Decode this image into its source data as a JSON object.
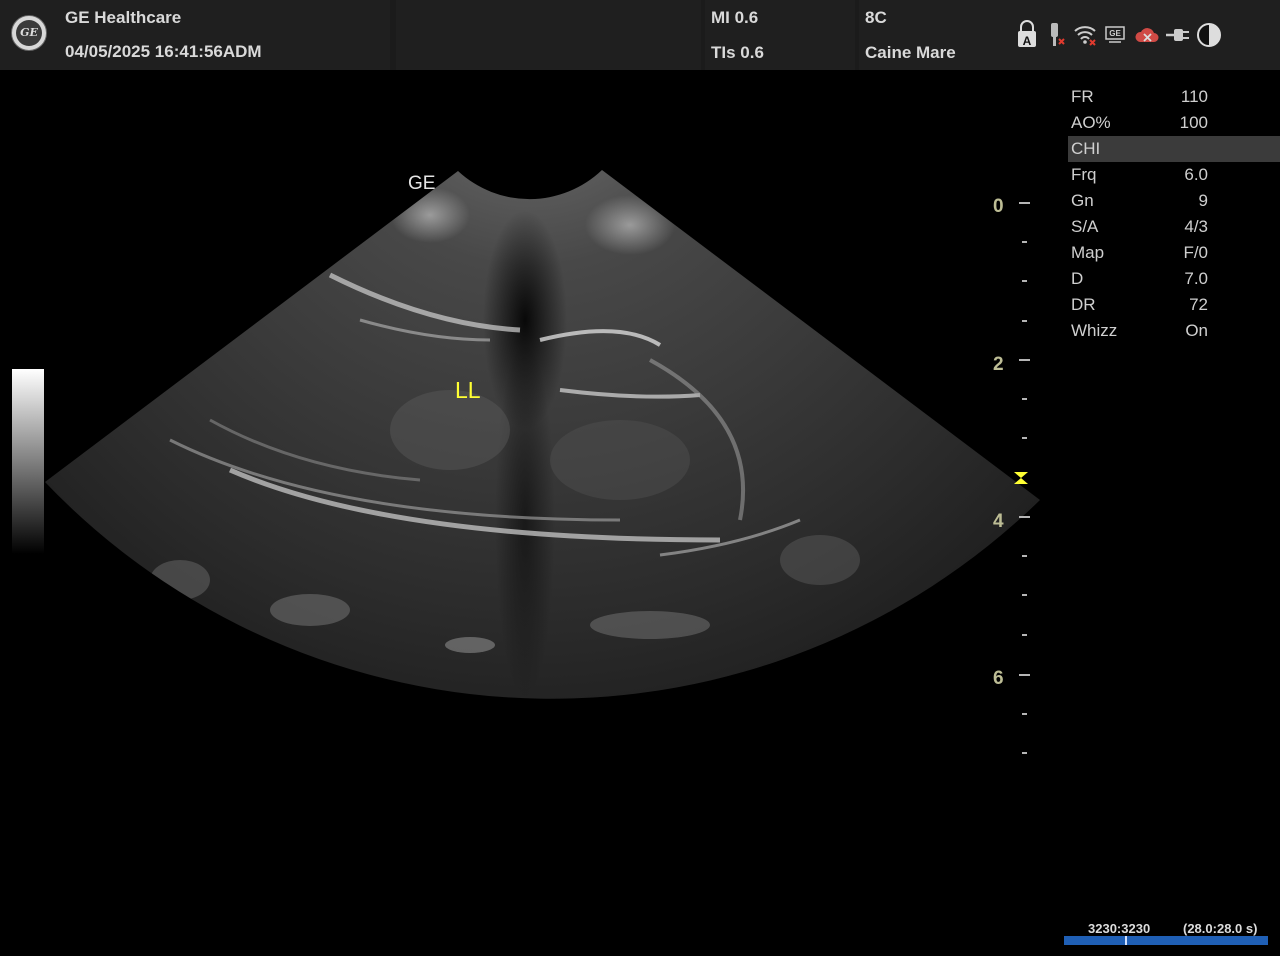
{
  "header": {
    "brand": "GE Healthcare",
    "datetime": "04/05/2025  16:41:56ADM",
    "mi": "MI 0.6",
    "tis": "TIs 0.6",
    "probe": "8C",
    "patient": "Caine Mare",
    "status_icons": [
      "keyboard-lock-icon",
      "probe-battery-icon",
      "wifi-disconnected-icon",
      "network-icon",
      "cloud-disconnected-icon",
      "power-plug-icon",
      "contrast-icon"
    ]
  },
  "params": [
    {
      "label": "FR",
      "value": "110"
    },
    {
      "label": "AO%",
      "value": "100"
    },
    {
      "label": "CHI",
      "value": ""
    },
    {
      "label": "Frq",
      "value": "6.0"
    },
    {
      "label": "Gn",
      "value": "9"
    },
    {
      "label": "S/A",
      "value": "4/3"
    },
    {
      "label": "Map",
      "value": "F/0"
    },
    {
      "label": "D",
      "value": "7.0"
    },
    {
      "label": "DR",
      "value": "72"
    },
    {
      "label": "Whizz",
      "value": "On"
    }
  ],
  "image": {
    "annotation": "LL",
    "orientation_mark": "GE",
    "depth_labels": [
      "0",
      "2",
      "4",
      "6"
    ],
    "annotation_color": "#ffff33"
  },
  "cine": {
    "frames": "3230:3230",
    "time": "(28.0:28.0 s)",
    "position": 0.3
  }
}
